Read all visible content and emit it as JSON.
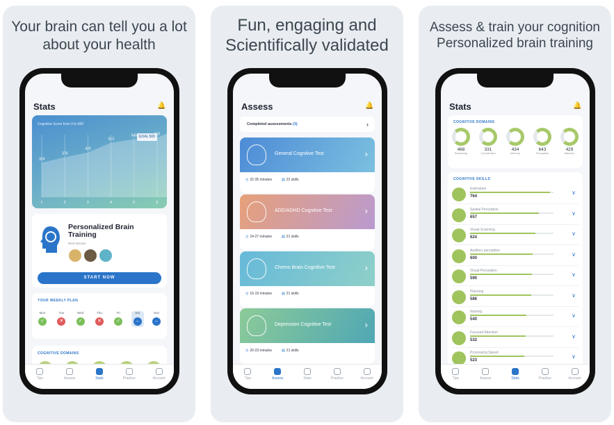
{
  "panels": [
    {
      "title_line1": "Your brain can tell you a lot",
      "title_line2": "about your health"
    },
    {
      "title_line1": "Fun, engaging and",
      "title_line2": "Scientifically validated"
    },
    {
      "title_line1": "Assess & train your cognition",
      "title_line2": "Personalized brain training"
    }
  ],
  "screen1": {
    "header": "Stats",
    "chart": {
      "caption": "Cognitive Score from 0 to 800",
      "goal": "GOAL 500",
      "points": [
        324,
        376,
        420,
        513,
        545,
        560
      ],
      "labels": [
        "324",
        "376",
        "420",
        "513",
        "545",
        "560"
      ],
      "x_ticks": [
        "1",
        "2",
        "3",
        "4",
        "5",
        "6"
      ]
    },
    "brain_program": {
      "title": "Personalized Brain Training",
      "subtitle": "Next session",
      "start": "START NOW"
    },
    "weekly_plan": {
      "title": "YOUR WEEKLY PLAN",
      "days": [
        {
          "label": "Mon",
          "state": "done"
        },
        {
          "label": "Tue",
          "state": "missed"
        },
        {
          "label": "Wed",
          "state": "done"
        },
        {
          "label": "Thu",
          "state": "missed"
        },
        {
          "label": "Fri",
          "state": "done"
        },
        {
          "label": "Sat",
          "state": "today"
        },
        {
          "label": "Sun",
          "state": "upcoming"
        }
      ]
    },
    "domains_title": "COGNITIVE DOMAINS",
    "tabs": [
      "Tips",
      "Assess",
      "Stats",
      "Practice",
      "Account"
    ]
  },
  "screen2": {
    "header": "Assess",
    "completed": {
      "label": "Completed assessments",
      "count": "(3)"
    },
    "tests": [
      {
        "name": "General Cognitive Test",
        "time": "32-35 minutes",
        "skills": "22 skills",
        "color_a": "#4d8bd6",
        "color_b": "#7cc0e0"
      },
      {
        "name": "ADD/ADHD Cognitive Test",
        "time": "24-27 minutes",
        "skills": "21 skills",
        "color_a": "#e7a079",
        "color_b": "#b99ad0"
      },
      {
        "name": "Chemo Brain Cognitive Test",
        "time": "16-19 minutes",
        "skills": "21 skills",
        "color_a": "#66b9d9",
        "color_b": "#8fd0c9"
      },
      {
        "name": "Depression Cognitive Test",
        "time": "20-23 minutes",
        "skills": "21 skills",
        "color_a": "#8ccb98",
        "color_b": "#4fa7b5"
      }
    ],
    "tabs": [
      "Tips",
      "Assess",
      "Stats",
      "Practice",
      "Account"
    ]
  },
  "screen3": {
    "header": "Stats",
    "domains_title": "COGNITIVE DOMAINS",
    "domains": [
      {
        "value": "468",
        "label": "Reasoning"
      },
      {
        "value": "331",
        "label": "Coordination"
      },
      {
        "value": "434",
        "label": "Memory"
      },
      {
        "value": "643",
        "label": "Perception"
      },
      {
        "value": "429",
        "label": "Attention"
      }
    ],
    "skills_title": "COGNITIVE SKILLS",
    "skills": [
      {
        "name": "Estimation",
        "value": "764"
      },
      {
        "name": "Spatial Perception",
        "value": "657"
      },
      {
        "name": "Visual Scanning",
        "value": "624"
      },
      {
        "name": "Auditory perception",
        "value": "600"
      },
      {
        "name": "Visual Perception",
        "value": "590"
      },
      {
        "name": "Planning",
        "value": "586"
      },
      {
        "name": "Naming",
        "value": "540"
      },
      {
        "name": "Focused Attention",
        "value": "532"
      },
      {
        "name": "Processing Speed",
        "value": "523"
      }
    ],
    "tabs": [
      "Tips",
      "Assess",
      "Stats",
      "Practice",
      "Account"
    ]
  },
  "colors": {
    "accent": "#2a75c9",
    "skill_green": "#9fc45d",
    "missed_red": "#e05a5a",
    "done_green": "#7bbf5a"
  }
}
